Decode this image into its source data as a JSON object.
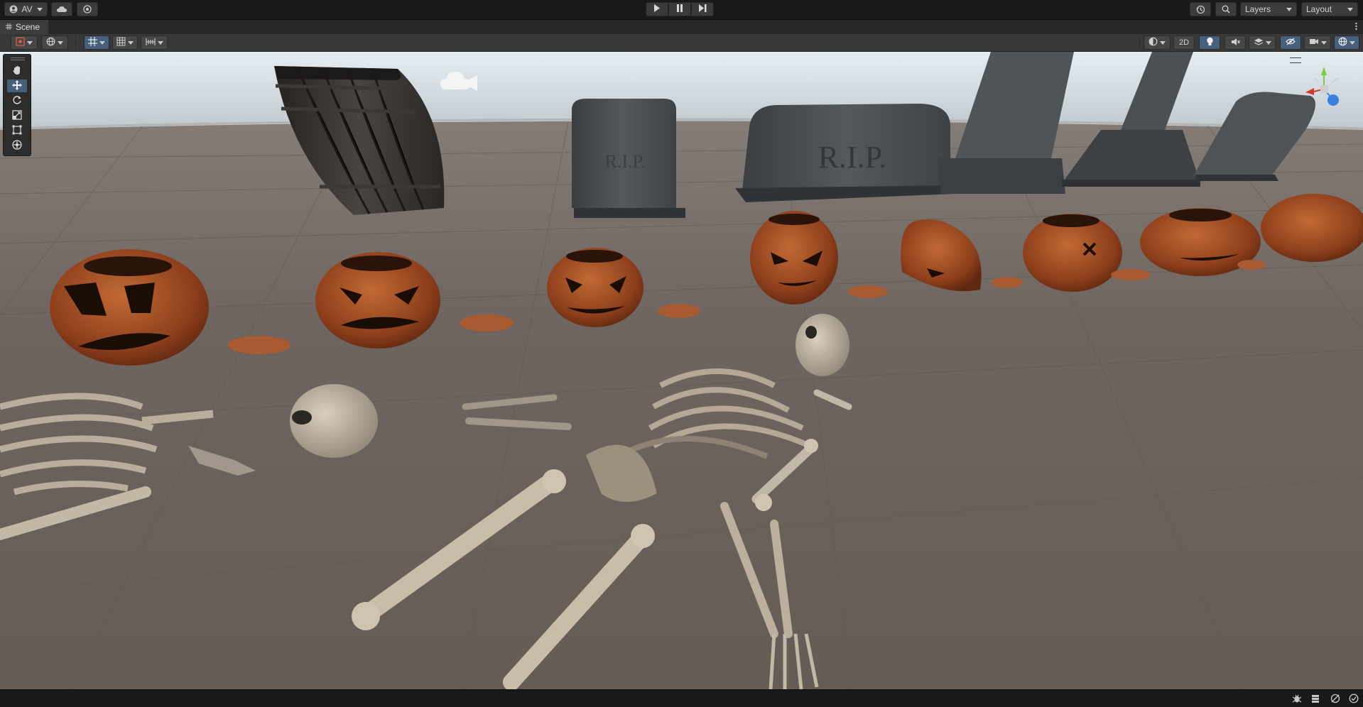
{
  "toolbar": {
    "account_label": "AV",
    "layers_label": "Layers",
    "layout_label": "Layout"
  },
  "scene_tab": {
    "title": "Scene"
  },
  "scene_toolbar": {
    "mode_2d_label": "2D"
  },
  "viewport": {
    "tombstone_text": "R.I.P.",
    "tombstone_small_text": "R.I.P."
  },
  "gizmo": {
    "axis_colors": {
      "x": "#d3392a",
      "y": "#7ccb42",
      "z": "#3a7fe0"
    }
  },
  "colors": {
    "active_tool": "#46607c",
    "ground": "#6b625c",
    "pumpkin": "#a24f24",
    "bone": "#c9bda8"
  }
}
